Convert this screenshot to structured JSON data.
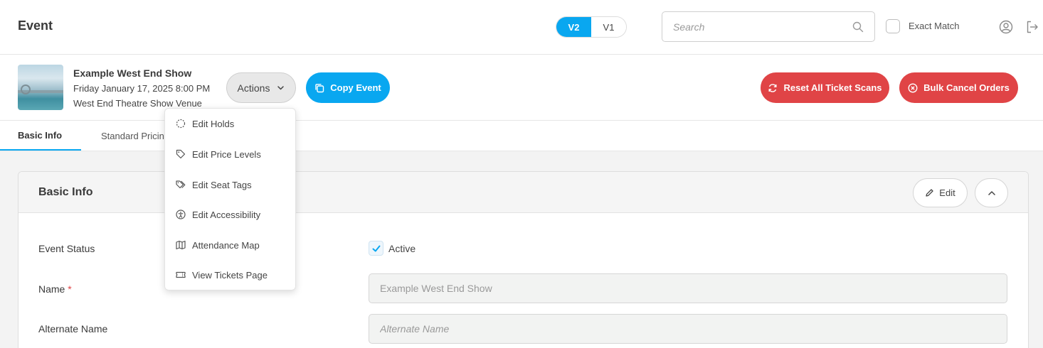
{
  "header": {
    "title": "Event",
    "version_toggle": {
      "v2": "V2",
      "v1": "V1",
      "selected": "V2"
    },
    "search": {
      "placeholder": "Search",
      "value": ""
    },
    "exact_match_label": "Exact Match",
    "exact_match_checked": false,
    "icons": {
      "search": "search-icon",
      "user": "user-circle-icon",
      "logout": "logout-icon"
    }
  },
  "event": {
    "name": "Example West End Show",
    "date": "Friday January 17, 2025 8:00 PM",
    "venue": "West End Theatre Show Venue"
  },
  "toolbar": {
    "actions_label": "Actions",
    "copy_label": "Copy Event",
    "reset_label": "Reset All Ticket Scans",
    "bulk_cancel_label": "Bulk Cancel Orders"
  },
  "actions_menu": [
    {
      "label": "Edit Holds",
      "icon": "dashed-circle-icon"
    },
    {
      "label": "Edit Price Levels",
      "icon": "tag-icon"
    },
    {
      "label": "Edit Seat Tags",
      "icon": "tags-icon"
    },
    {
      "label": "Edit Accessibility",
      "icon": "accessibility-icon"
    },
    {
      "label": "Attendance Map",
      "icon": "map-icon"
    },
    {
      "label": "View Tickets Page",
      "icon": "ticket-icon"
    }
  ],
  "tabs": [
    {
      "label": "Basic Info",
      "active": true
    },
    {
      "label": "Standard Pricing",
      "active": false
    }
  ],
  "card": {
    "title": "Basic Info",
    "edit_label": "Edit",
    "fields": {
      "event_status_label": "Event Status",
      "active_label": "Active",
      "active_checked": true,
      "name_label": "Name",
      "name_required": "*",
      "name_value": "Example West End Show",
      "alternate_name_label": "Alternate Name",
      "alternate_name_placeholder": "Alternate Name"
    }
  },
  "colors": {
    "primary": "#09a7f0",
    "danger": "#e04446",
    "text": "#3a3a3a"
  }
}
